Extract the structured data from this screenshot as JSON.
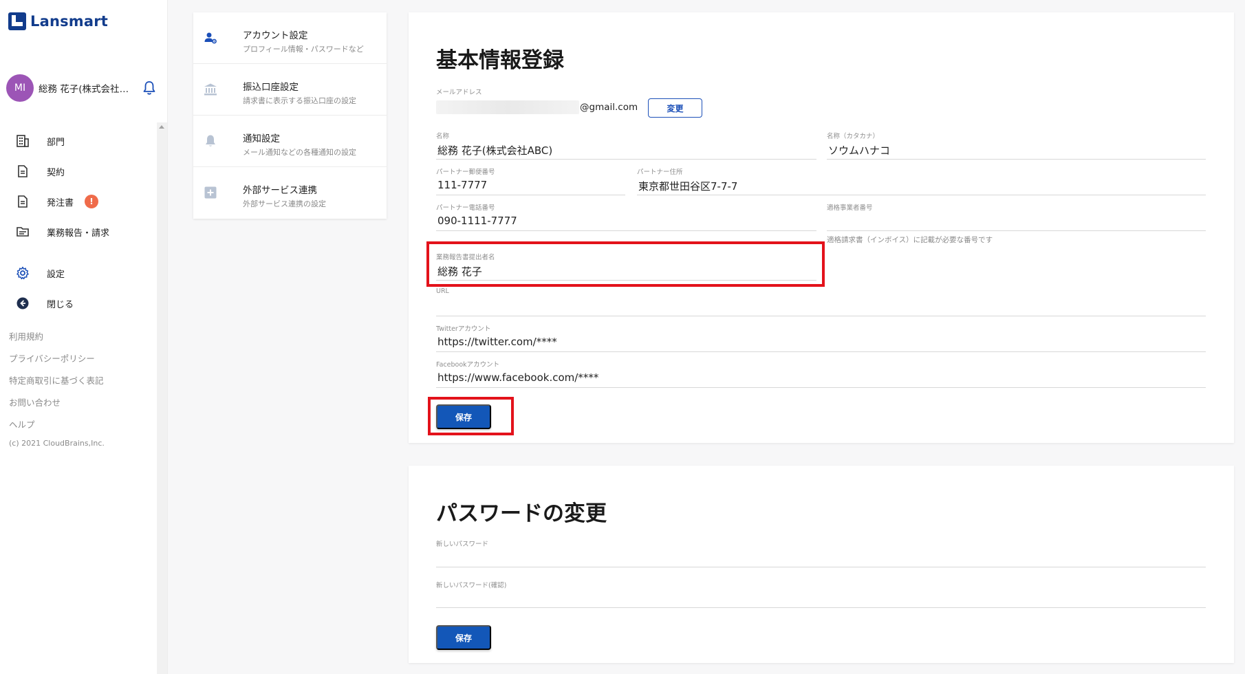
{
  "app": {
    "logo_text": "Lansmart"
  },
  "user": {
    "initials": "MI",
    "name": "総務 花子(株式会社ABC)"
  },
  "colors": {
    "brand": "#123c8c",
    "primary_button": "#1357b8",
    "avatar": "#9c55b6",
    "alert_badge": "#ef6b4a",
    "highlight": "#e3121b"
  },
  "sidebar": {
    "items": [
      {
        "label": "部門",
        "icon": "building-icon"
      },
      {
        "label": "契約",
        "icon": "document-icon"
      },
      {
        "label": "発注書",
        "icon": "document-icon",
        "badge": "!"
      },
      {
        "label": "業務報告・請求",
        "icon": "report-icon"
      },
      {
        "label": "設定",
        "icon": "gear-icon"
      },
      {
        "label": "閉じる",
        "icon": "back-arrow-icon"
      }
    ],
    "footer_links": [
      "利用規約",
      "プライバシーポリシー",
      "特定商取引に基づく表記",
      "お問い合わせ",
      "ヘルプ"
    ],
    "copyright": "(c) 2021 CloudBrains,Inc."
  },
  "settings_menu": [
    {
      "title": "アカウント設定",
      "subtitle": "プロフィール情報・パスワードなど",
      "icon": "account-settings-icon"
    },
    {
      "title": "振込口座設定",
      "subtitle": "請求書に表示する振込口座の設定",
      "icon": "bank-icon"
    },
    {
      "title": "通知設定",
      "subtitle": "メール通知などの各種通知の設定",
      "icon": "bell-icon"
    },
    {
      "title": "外部サービス連携",
      "subtitle": "外部サービス連携の設定",
      "icon": "plus-box-icon"
    }
  ],
  "basic_info": {
    "title": "基本情報登録",
    "email": {
      "label": "メールアドレス",
      "value": "@gmail.com",
      "change_label": "変更"
    },
    "name": {
      "label": "名称",
      "value": "総務 花子(株式会社ABC)"
    },
    "name_kana": {
      "label": "名称（カタカナ）",
      "value": "ソウムハナコ"
    },
    "postal": {
      "label": "パートナー郵便番号",
      "value": "111-7777"
    },
    "address": {
      "label": "パートナー住所",
      "value": "東京都世田谷区7-7-7"
    },
    "phone": {
      "label": "パートナー電話番号",
      "value": "090-1111-7777"
    },
    "invoice_no": {
      "label": "適格事業者番号",
      "value": "",
      "hint": "適格請求書（インボイス）に記載が必要な番号です"
    },
    "submitter": {
      "label": "業務報告書提出者名",
      "value": "総務 花子"
    },
    "url": {
      "label": "URL",
      "value": ""
    },
    "twitter": {
      "label": "Twitterアカウント",
      "value": "https://twitter.com/****"
    },
    "facebook": {
      "label": "Facebookアカウント",
      "value": "https://www.facebook.com/****"
    },
    "save_label": "保存"
  },
  "password_change": {
    "title": "パスワードの変更",
    "new_password": {
      "label": "新しいパスワード"
    },
    "confirm_password": {
      "label": "新しいパスワード(確認)"
    },
    "save_label": "保存"
  }
}
